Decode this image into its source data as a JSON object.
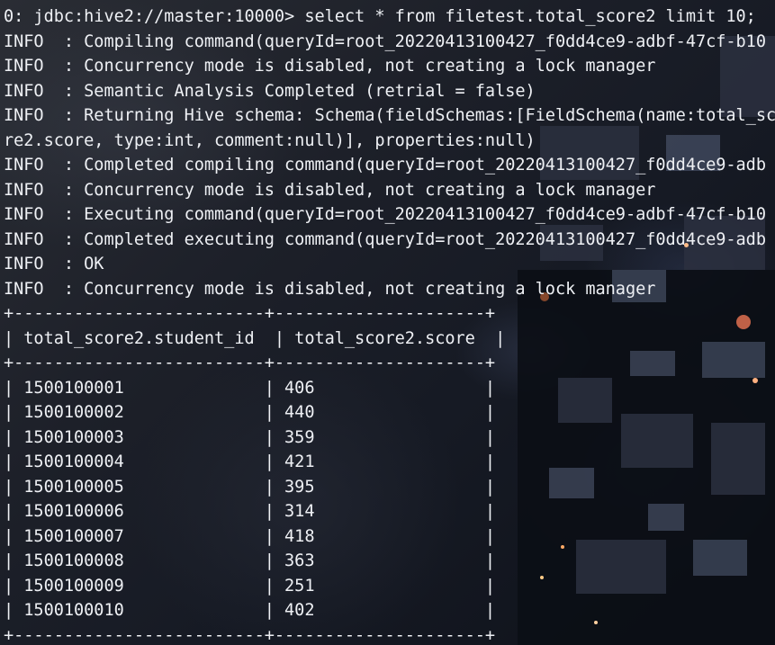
{
  "terminal": {
    "lines": [
      "0: jdbc:hive2://master:10000> select * from filetest.total_score2 limit 10;",
      "INFO  : Compiling command(queryId=root_20220413100427_f0dd4ce9-adbf-47cf-b10",
      "INFO  : Concurrency mode is disabled, not creating a lock manager",
      "INFO  : Semantic Analysis Completed (retrial = false)",
      "INFO  : Returning Hive schema: Schema(fieldSchemas:[FieldSchema(name:total_sc",
      "re2.score, type:int, comment:null)], properties:null)",
      "INFO  : Completed compiling command(queryId=root_20220413100427_f0dd4ce9-adb",
      "INFO  : Concurrency mode is disabled, not creating a lock manager",
      "INFO  : Executing command(queryId=root_20220413100427_f0dd4ce9-adbf-47cf-b10",
      "INFO  : Completed executing command(queryId=root_20220413100427_f0dd4ce9-adb",
      "INFO  : OK",
      "INFO  : Concurrency mode is disabled, not creating a lock manager",
      "+-------------------------+---------------------+",
      "| total_score2.student_id  | total_score2.score  |",
      "+-------------------------+---------------------+",
      "| 1500100001              | 406                 |",
      "| 1500100002              | 440                 |",
      "| 1500100003              | 359                 |",
      "| 1500100004              | 421                 |",
      "| 1500100005              | 395                 |",
      "| 1500100006              | 314                 |",
      "| 1500100007              | 418                 |",
      "| 1500100008              | 363                 |",
      "| 1500100009              | 251                 |",
      "| 1500100010              | 402                 |",
      "+-------------------------+---------------------+"
    ],
    "colors": {
      "text": "#eef0f4",
      "background": "#1a1d25"
    }
  }
}
